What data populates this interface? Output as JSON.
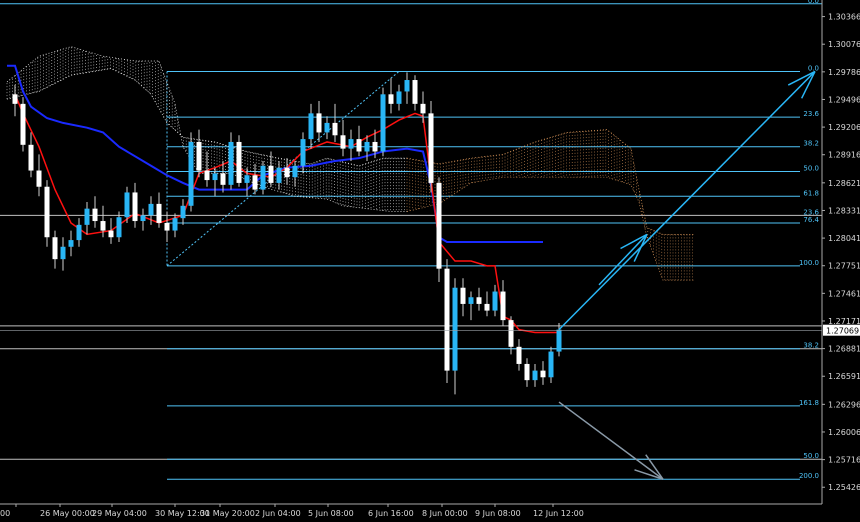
{
  "chart_data": {
    "type": "candlestick",
    "ylim": [
      1.2525,
      1.3054
    ],
    "y_ticks": [
      "1.30366",
      "1.30076",
      "1.29786",
      "1.29496",
      "1.29206",
      "1.28916",
      "1.28621",
      "1.28331",
      "1.28041",
      "1.27751",
      "1.27461",
      "1.27171",
      "1.26881",
      "1.26591",
      "1.26296",
      "1.26006",
      "1.25716",
      "1.25426"
    ],
    "current_price": "1.27069",
    "x_ticks": [
      "00",
      "26 May 00:00",
      "29 May 04:00",
      "30 May 12:00",
      "31 May 20:00",
      "2 Jun 04:00",
      "5 Jun 08:00",
      "6 Jun 16:00",
      "8 Jun 00:00",
      "9 Jun 08:00",
      "12 Jun 12:00"
    ],
    "bars": 140,
    "candles": [
      {
        "i": 1,
        "o": 1.2955,
        "h": 1.2965,
        "l": 1.2932,
        "c": 1.2945
      },
      {
        "i": 2,
        "o": 1.2945,
        "h": 1.2952,
        "l": 1.2895,
        "c": 1.2902
      },
      {
        "i": 3,
        "o": 1.2902,
        "h": 1.2915,
        "l": 1.2868,
        "c": 1.2875
      },
      {
        "i": 4,
        "o": 1.2875,
        "h": 1.2892,
        "l": 1.2848,
        "c": 1.2858
      },
      {
        "i": 5,
        "o": 1.2858,
        "h": 1.2865,
        "l": 1.2795,
        "c": 1.2805
      },
      {
        "i": 6,
        "o": 1.2805,
        "h": 1.2812,
        "l": 1.2772,
        "c": 1.2782
      },
      {
        "i": 7,
        "o": 1.2782,
        "h": 1.2805,
        "l": 1.277,
        "c": 1.2795
      },
      {
        "i": 8,
        "o": 1.2795,
        "h": 1.2812,
        "l": 1.2785,
        "c": 1.2802
      },
      {
        "i": 9,
        "o": 1.2802,
        "h": 1.2825,
        "l": 1.2795,
        "c": 1.2818
      },
      {
        "i": 10,
        "o": 1.2818,
        "h": 1.2842,
        "l": 1.2808,
        "c": 1.2835
      },
      {
        "i": 11,
        "o": 1.2835,
        "h": 1.2848,
        "l": 1.2815,
        "c": 1.2822
      },
      {
        "i": 12,
        "o": 1.2822,
        "h": 1.2838,
        "l": 1.2805,
        "c": 1.2812
      },
      {
        "i": 13,
        "o": 1.2812,
        "h": 1.2825,
        "l": 1.2798,
        "c": 1.2805
      },
      {
        "i": 14,
        "o": 1.2805,
        "h": 1.2832,
        "l": 1.28,
        "c": 1.2826
      },
      {
        "i": 15,
        "o": 1.2826,
        "h": 1.2858,
        "l": 1.282,
        "c": 1.2852
      },
      {
        "i": 16,
        "o": 1.2852,
        "h": 1.2862,
        "l": 1.2815,
        "c": 1.2822
      },
      {
        "i": 17,
        "o": 1.2822,
        "h": 1.2835,
        "l": 1.2812,
        "c": 1.2828
      },
      {
        "i": 18,
        "o": 1.2828,
        "h": 1.2848,
        "l": 1.2818,
        "c": 1.284
      },
      {
        "i": 19,
        "o": 1.284,
        "h": 1.2852,
        "l": 1.2815,
        "c": 1.282
      },
      {
        "i": 20,
        "o": 1.282,
        "h": 1.2832,
        "l": 1.28,
        "c": 1.2812
      },
      {
        "i": 21,
        "o": 1.2812,
        "h": 1.283,
        "l": 1.2805,
        "c": 1.2825
      },
      {
        "i": 22,
        "o": 1.2825,
        "h": 1.2845,
        "l": 1.2818,
        "c": 1.2838
      },
      {
        "i": 23,
        "o": 1.2838,
        "h": 1.2915,
        "l": 1.2832,
        "c": 1.2905
      },
      {
        "i": 24,
        "o": 1.2905,
        "h": 1.2918,
        "l": 1.2868,
        "c": 1.2875
      },
      {
        "i": 25,
        "o": 1.2875,
        "h": 1.2895,
        "l": 1.2858,
        "c": 1.2865
      },
      {
        "i": 26,
        "o": 1.2865,
        "h": 1.2878,
        "l": 1.2848,
        "c": 1.2872
      },
      {
        "i": 27,
        "o": 1.2872,
        "h": 1.2885,
        "l": 1.2852,
        "c": 1.286
      },
      {
        "i": 28,
        "o": 1.286,
        "h": 1.2915,
        "l": 1.2855,
        "c": 1.2905
      },
      {
        "i": 29,
        "o": 1.2905,
        "h": 1.2912,
        "l": 1.2858,
        "c": 1.2862
      },
      {
        "i": 30,
        "o": 1.2862,
        "h": 1.2878,
        "l": 1.2848,
        "c": 1.287
      },
      {
        "i": 31,
        "o": 1.287,
        "h": 1.2882,
        "l": 1.285,
        "c": 1.2855
      },
      {
        "i": 32,
        "o": 1.2855,
        "h": 1.2885,
        "l": 1.285,
        "c": 1.288
      },
      {
        "i": 33,
        "o": 1.288,
        "h": 1.2895,
        "l": 1.2858,
        "c": 1.2862
      },
      {
        "i": 34,
        "o": 1.2862,
        "h": 1.2885,
        "l": 1.2855,
        "c": 1.2878
      },
      {
        "i": 35,
        "o": 1.2878,
        "h": 1.2888,
        "l": 1.286,
        "c": 1.2868
      },
      {
        "i": 36,
        "o": 1.2868,
        "h": 1.2885,
        "l": 1.2858,
        "c": 1.288
      },
      {
        "i": 37,
        "o": 1.288,
        "h": 1.2915,
        "l": 1.2872,
        "c": 1.2908
      },
      {
        "i": 38,
        "o": 1.2908,
        "h": 1.2945,
        "l": 1.2898,
        "c": 1.2935
      },
      {
        "i": 39,
        "o": 1.2935,
        "h": 1.2948,
        "l": 1.2905,
        "c": 1.2915
      },
      {
        "i": 40,
        "o": 1.2915,
        "h": 1.2932,
        "l": 1.2908,
        "c": 1.2925
      },
      {
        "i": 41,
        "o": 1.2925,
        "h": 1.2945,
        "l": 1.2905,
        "c": 1.2912
      },
      {
        "i": 42,
        "o": 1.2912,
        "h": 1.2928,
        "l": 1.289,
        "c": 1.2898
      },
      {
        "i": 43,
        "o": 1.2898,
        "h": 1.2918,
        "l": 1.2885,
        "c": 1.2908
      },
      {
        "i": 44,
        "o": 1.2908,
        "h": 1.2922,
        "l": 1.289,
        "c": 1.2895
      },
      {
        "i": 45,
        "o": 1.2895,
        "h": 1.2912,
        "l": 1.2885,
        "c": 1.2905
      },
      {
        "i": 46,
        "o": 1.2905,
        "h": 1.2918,
        "l": 1.2888,
        "c": 1.2895
      },
      {
        "i": 47,
        "o": 1.2895,
        "h": 1.2962,
        "l": 1.289,
        "c": 1.2955
      },
      {
        "i": 48,
        "o": 1.2955,
        "h": 1.2972,
        "l": 1.2935,
        "c": 1.2945
      },
      {
        "i": 49,
        "o": 1.2945,
        "h": 1.2965,
        "l": 1.2938,
        "c": 1.2958
      },
      {
        "i": 50,
        "o": 1.2958,
        "h": 1.2978,
        "l": 1.2945,
        "c": 1.297
      },
      {
        "i": 51,
        "o": 1.297,
        "h": 1.2975,
        "l": 1.2938,
        "c": 1.2945
      },
      {
        "i": 52,
        "o": 1.2945,
        "h": 1.2958,
        "l": 1.2925,
        "c": 1.2935
      },
      {
        "i": 53,
        "o": 1.2935,
        "h": 1.2948,
        "l": 1.2852,
        "c": 1.2862
      },
      {
        "i": 54,
        "o": 1.2862,
        "h": 1.2868,
        "l": 1.2758,
        "c": 1.2772
      },
      {
        "i": 55,
        "o": 1.2772,
        "h": 1.2782,
        "l": 1.2652,
        "c": 1.2665
      },
      {
        "i": 56,
        "o": 1.2665,
        "h": 1.2762,
        "l": 1.264,
        "c": 1.2752
      },
      {
        "i": 57,
        "o": 1.2752,
        "h": 1.2762,
        "l": 1.2722,
        "c": 1.2735
      },
      {
        "i": 58,
        "o": 1.2735,
        "h": 1.2748,
        "l": 1.2718,
        "c": 1.2742
      },
      {
        "i": 59,
        "o": 1.2742,
        "h": 1.2752,
        "l": 1.2728,
        "c": 1.2735
      },
      {
        "i": 60,
        "o": 1.2735,
        "h": 1.2748,
        "l": 1.2722,
        "c": 1.2728
      },
      {
        "i": 61,
        "o": 1.2728,
        "h": 1.2755,
        "l": 1.2722,
        "c": 1.2748
      },
      {
        "i": 62,
        "o": 1.2748,
        "h": 1.276,
        "l": 1.2712,
        "c": 1.2718
      },
      {
        "i": 63,
        "o": 1.2718,
        "h": 1.2722,
        "l": 1.2682,
        "c": 1.269
      },
      {
        "i": 64,
        "o": 1.269,
        "h": 1.2698,
        "l": 1.2665,
        "c": 1.2672
      },
      {
        "i": 65,
        "o": 1.2672,
        "h": 1.2678,
        "l": 1.2648,
        "c": 1.2655
      },
      {
        "i": 66,
        "o": 1.2655,
        "h": 1.2672,
        "l": 1.2648,
        "c": 1.2665
      },
      {
        "i": 67,
        "o": 1.2665,
        "h": 1.2675,
        "l": 1.265,
        "c": 1.2658
      },
      {
        "i": 68,
        "o": 1.2658,
        "h": 1.269,
        "l": 1.2652,
        "c": 1.2685
      },
      {
        "i": 69,
        "o": 1.2685,
        "h": 1.2715,
        "l": 1.268,
        "c": 1.2708
      }
    ],
    "tenkan": [
      [
        1,
        1.2955
      ],
      [
        2,
        1.2935
      ],
      [
        4,
        1.29
      ],
      [
        6,
        1.2855
      ],
      [
        8,
        1.282
      ],
      [
        10,
        1.2808
      ],
      [
        13,
        1.2812
      ],
      [
        16,
        1.283
      ],
      [
        19,
        1.282
      ],
      [
        22,
        1.2828
      ],
      [
        24,
        1.2872
      ],
      [
        26,
        1.2878
      ],
      [
        28,
        1.2885
      ],
      [
        30,
        1.2872
      ],
      [
        33,
        1.2868
      ],
      [
        35,
        1.2878
      ],
      [
        37,
        1.2895
      ],
      [
        40,
        1.2905
      ],
      [
        43,
        1.29
      ],
      [
        45,
        1.291
      ],
      [
        47,
        1.2918
      ],
      [
        49,
        1.2928
      ],
      [
        51,
        1.2935
      ],
      [
        52,
        1.2932
      ],
      [
        53,
        1.2865
      ],
      [
        54,
        1.28
      ],
      [
        56,
        1.278
      ],
      [
        58,
        1.278
      ],
      [
        60,
        1.2775
      ],
      [
        61,
        1.2775
      ],
      [
        62,
        1.2722
      ],
      [
        63,
        1.2718
      ],
      [
        64,
        1.2708
      ],
      [
        66,
        1.2705
      ],
      [
        68,
        1.2705
      ],
      [
        69,
        1.2705
      ]
    ],
    "kijun": [
      [
        0,
        1.2985
      ],
      [
        1,
        1.2985
      ],
      [
        2,
        1.2958
      ],
      [
        3,
        1.2942
      ],
      [
        5,
        1.293
      ],
      [
        7,
        1.2925
      ],
      [
        10,
        1.292
      ],
      [
        12,
        1.2915
      ],
      [
        14,
        1.29
      ],
      [
        18,
        1.288
      ],
      [
        20,
        1.287
      ],
      [
        22,
        1.2862
      ],
      [
        24,
        1.2855
      ],
      [
        30,
        1.2855
      ],
      [
        32,
        1.287
      ],
      [
        35,
        1.2878
      ],
      [
        38,
        1.288
      ],
      [
        41,
        1.2885
      ],
      [
        44,
        1.2888
      ],
      [
        47,
        1.2895
      ],
      [
        50,
        1.2898
      ],
      [
        52,
        1.2895
      ],
      [
        53,
        1.286
      ],
      [
        54,
        1.2805
      ],
      [
        55,
        1.28
      ],
      [
        67,
        1.28
      ]
    ],
    "kumo": [
      {
        "span_a": [
          [
            0,
            1.295
          ],
          [
            4,
            1.2958
          ],
          [
            8,
            1.2975
          ],
          [
            13,
            1.2982
          ],
          [
            16,
            1.297
          ],
          [
            18,
            1.2955
          ],
          [
            20,
            1.2925
          ],
          [
            22,
            1.291
          ],
          [
            26,
            1.2905
          ],
          [
            30,
            1.2895
          ],
          [
            34,
            1.2888
          ],
          [
            38,
            1.2882
          ],
          [
            40,
            1.2888
          ],
          [
            44,
            1.288
          ],
          [
            47,
            1.2888
          ],
          [
            50,
            1.2888
          ]
        ],
        "span_b": [
          [
            0,
            1.2968
          ],
          [
            4,
            1.2995
          ],
          [
            8,
            1.3005
          ],
          [
            12,
            1.2995
          ],
          [
            16,
            1.299
          ],
          [
            19,
            1.299
          ],
          [
            21,
            1.2945
          ],
          [
            22,
            1.29
          ],
          [
            24,
            1.2872
          ],
          [
            28,
            1.2872
          ],
          [
            32,
            1.2858
          ],
          [
            36,
            1.2848
          ],
          [
            40,
            1.2845
          ],
          [
            42,
            1.2838
          ],
          [
            45,
            1.2835
          ],
          [
            48,
            1.2832
          ],
          [
            50,
            1.2832
          ]
        ],
        "color": "#ffffff"
      },
      {
        "span_a": [
          [
            50,
            1.2888
          ],
          [
            54,
            1.2882
          ],
          [
            58,
            1.2888
          ],
          [
            62,
            1.2892
          ],
          [
            66,
            1.2905
          ],
          [
            70,
            1.2915
          ],
          [
            75,
            1.2918
          ],
          [
            78,
            1.2898
          ],
          [
            79,
            1.2855
          ],
          [
            80,
            1.2815
          ],
          [
            82,
            1.2808
          ],
          [
            86,
            1.2808
          ]
        ],
        "span_b": [
          [
            50,
            1.2832
          ],
          [
            54,
            1.284
          ],
          [
            58,
            1.2862
          ],
          [
            62,
            1.2868
          ],
          [
            66,
            1.2868
          ],
          [
            70,
            1.2868
          ],
          [
            75,
            1.2868
          ],
          [
            78,
            1.286
          ],
          [
            79,
            1.2842
          ],
          [
            80,
            1.2805
          ],
          [
            82,
            1.276
          ],
          [
            86,
            1.276
          ]
        ],
        "color": "#e8a060"
      }
    ],
    "fib_upper": {
      "levels": [
        "0.0",
        "23.6",
        "38.2",
        "50.0",
        "61.8",
        "76.4",
        "100.0"
      ],
      "prices": [
        1.2979,
        1.2931,
        1.29,
        1.2874,
        1.2848,
        1.282,
        1.2775
      ]
    },
    "fib_lower": {
      "levels": [
        "38.2",
        "161.8",
        "50.0",
        "200.0"
      ],
      "prices": [
        1.2688,
        1.2628,
        1.2572,
        1.2551
      ]
    },
    "extra_levels": {
      "top": {
        "label": "0.0",
        "price": 1.305
      },
      "mid": {
        "label": "23.6",
        "price": 1.2828
      }
    },
    "white_lines": [
      1.2828,
      1.2712,
      1.2688,
      1.2572
    ],
    "trend_line": {
      "from": [
        20,
        1.2775
      ],
      "to": [
        49,
        1.2979
      ]
    },
    "arrows_up": [
      {
        "from": [
          69,
          1.2708
        ],
        "to": [
          101,
          1.2979
        ]
      },
      {
        "from": [
          74,
          1.2755
        ],
        "to": [
          80,
          1.2808
        ]
      }
    ],
    "arrow_down": {
      "from": [
        69,
        1.2632
      ],
      "to": [
        82,
        1.2551
      ]
    }
  }
}
